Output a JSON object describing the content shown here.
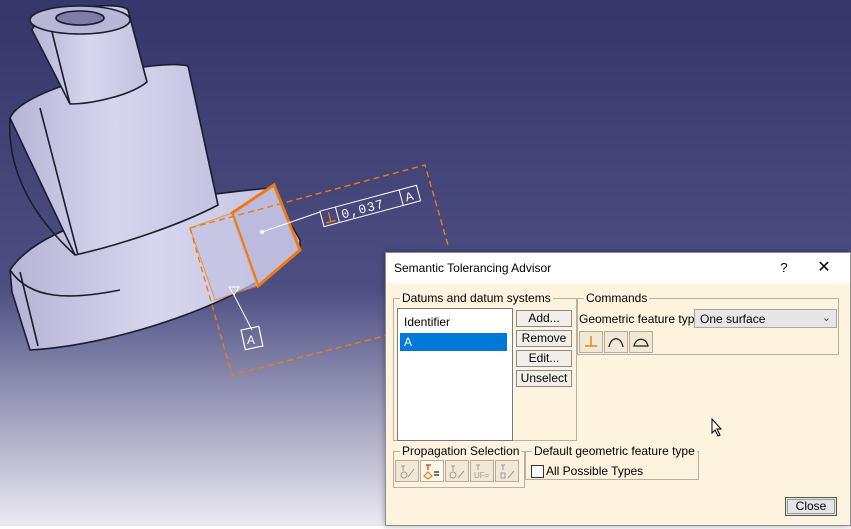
{
  "viewport": {
    "tolerance_value": "0,037",
    "tolerance_datum": "A",
    "datum_label": "A"
  },
  "dialog": {
    "title": "Semantic Tolerancing Advisor",
    "help_label": "?",
    "close_x_label": "✕",
    "datums": {
      "legend": "Datums and datum systems",
      "list": [
        "Identifier",
        "A"
      ],
      "selected": "A",
      "buttons": {
        "add": "Add...",
        "remove": "Remove",
        "edit": "Edit...",
        "unselect": "Unselect"
      }
    },
    "commands": {
      "legend": "Commands",
      "feature_type_label": "Geometric feature type",
      "feature_type_value": "One surface",
      "icons": [
        "perpendicularity-icon",
        "profile-of-line-icon",
        "profile-of-surface-icon"
      ]
    },
    "propagation": {
      "legend": "Propagation Selection",
      "icons": [
        "propagation-tangent-icon",
        "propagation-equal-icon",
        "propagation-point-icon",
        "propagation-uf-icon",
        "propagation-shape-icon"
      ]
    },
    "default_type": {
      "legend": "Default geometric feature type",
      "checkbox_label": "All Possible Types",
      "checked": false
    },
    "close_label": "Close"
  },
  "colors": {
    "background_top": "#36386a",
    "background_bottom": "#e8e8ee",
    "part": "#c9c8e6",
    "highlight": "#f07a12",
    "dialog_bg": "#fdf3df",
    "selection": "#0078d7"
  }
}
